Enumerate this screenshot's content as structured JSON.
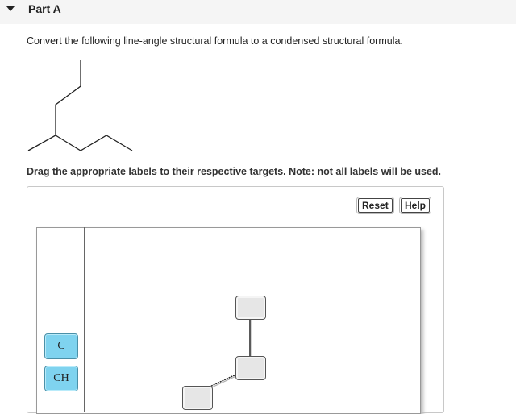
{
  "header": {
    "part_title": "Part A",
    "toggle_icon": "caret-down-icon"
  },
  "question": {
    "instruction": "Convert the following line-angle structural formula to a condensed structural formula."
  },
  "drag_drop": {
    "instruction": "Drag the appropriate labels to their respective targets. Note: not all labels will be used.",
    "reset_label": "Reset",
    "help_label": "Help",
    "labels": [
      "C",
      "CH"
    ]
  },
  "colors": {
    "label_tile": "#7fd3ef",
    "target_box": "#e6e6e6",
    "header_bg": "#f5f5f5"
  }
}
